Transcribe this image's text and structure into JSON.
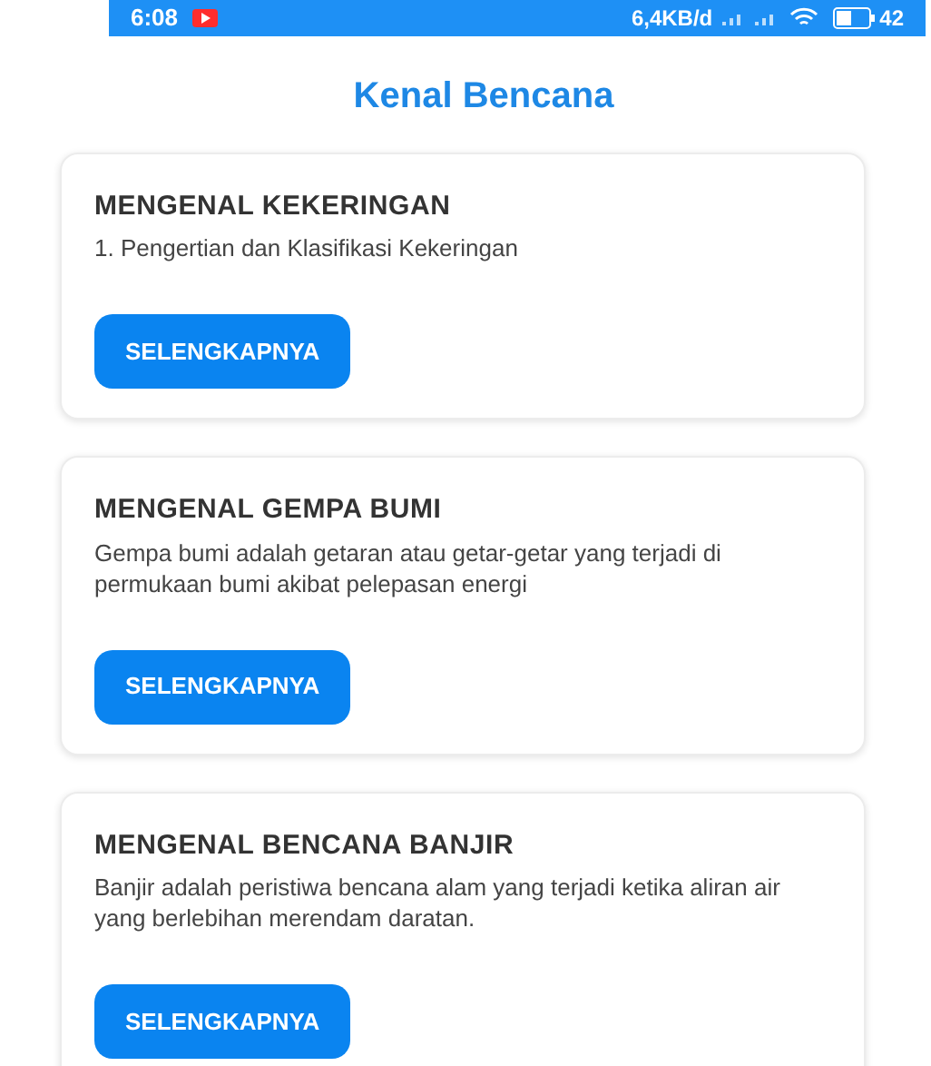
{
  "status_bar": {
    "time": "6:08",
    "network_speed": "6,4KB/d",
    "battery": "42"
  },
  "title": "Kenal Bencana",
  "cards": [
    {
      "title": "MENGENAL KEKERINGAN",
      "text": "1. Pengertian dan Klasifikasi Kekeringan",
      "button": "SELENGKAPNYA"
    },
    {
      "title": "MENGENAL GEMPA BUMI",
      "text": "Gempa bumi adalah getaran atau getar-getar yang terjadi di permukaan bumi akibat pelepasan energi",
      "button": "SELENGKAPNYA"
    },
    {
      "title": "MENGENAL BENCANA BANJIR",
      "text": "Banjir adalah peristiwa bencana alam yang terjadi ketika aliran air yang berlebihan merendam daratan.",
      "button": "SELENGKAPNYA"
    }
  ]
}
